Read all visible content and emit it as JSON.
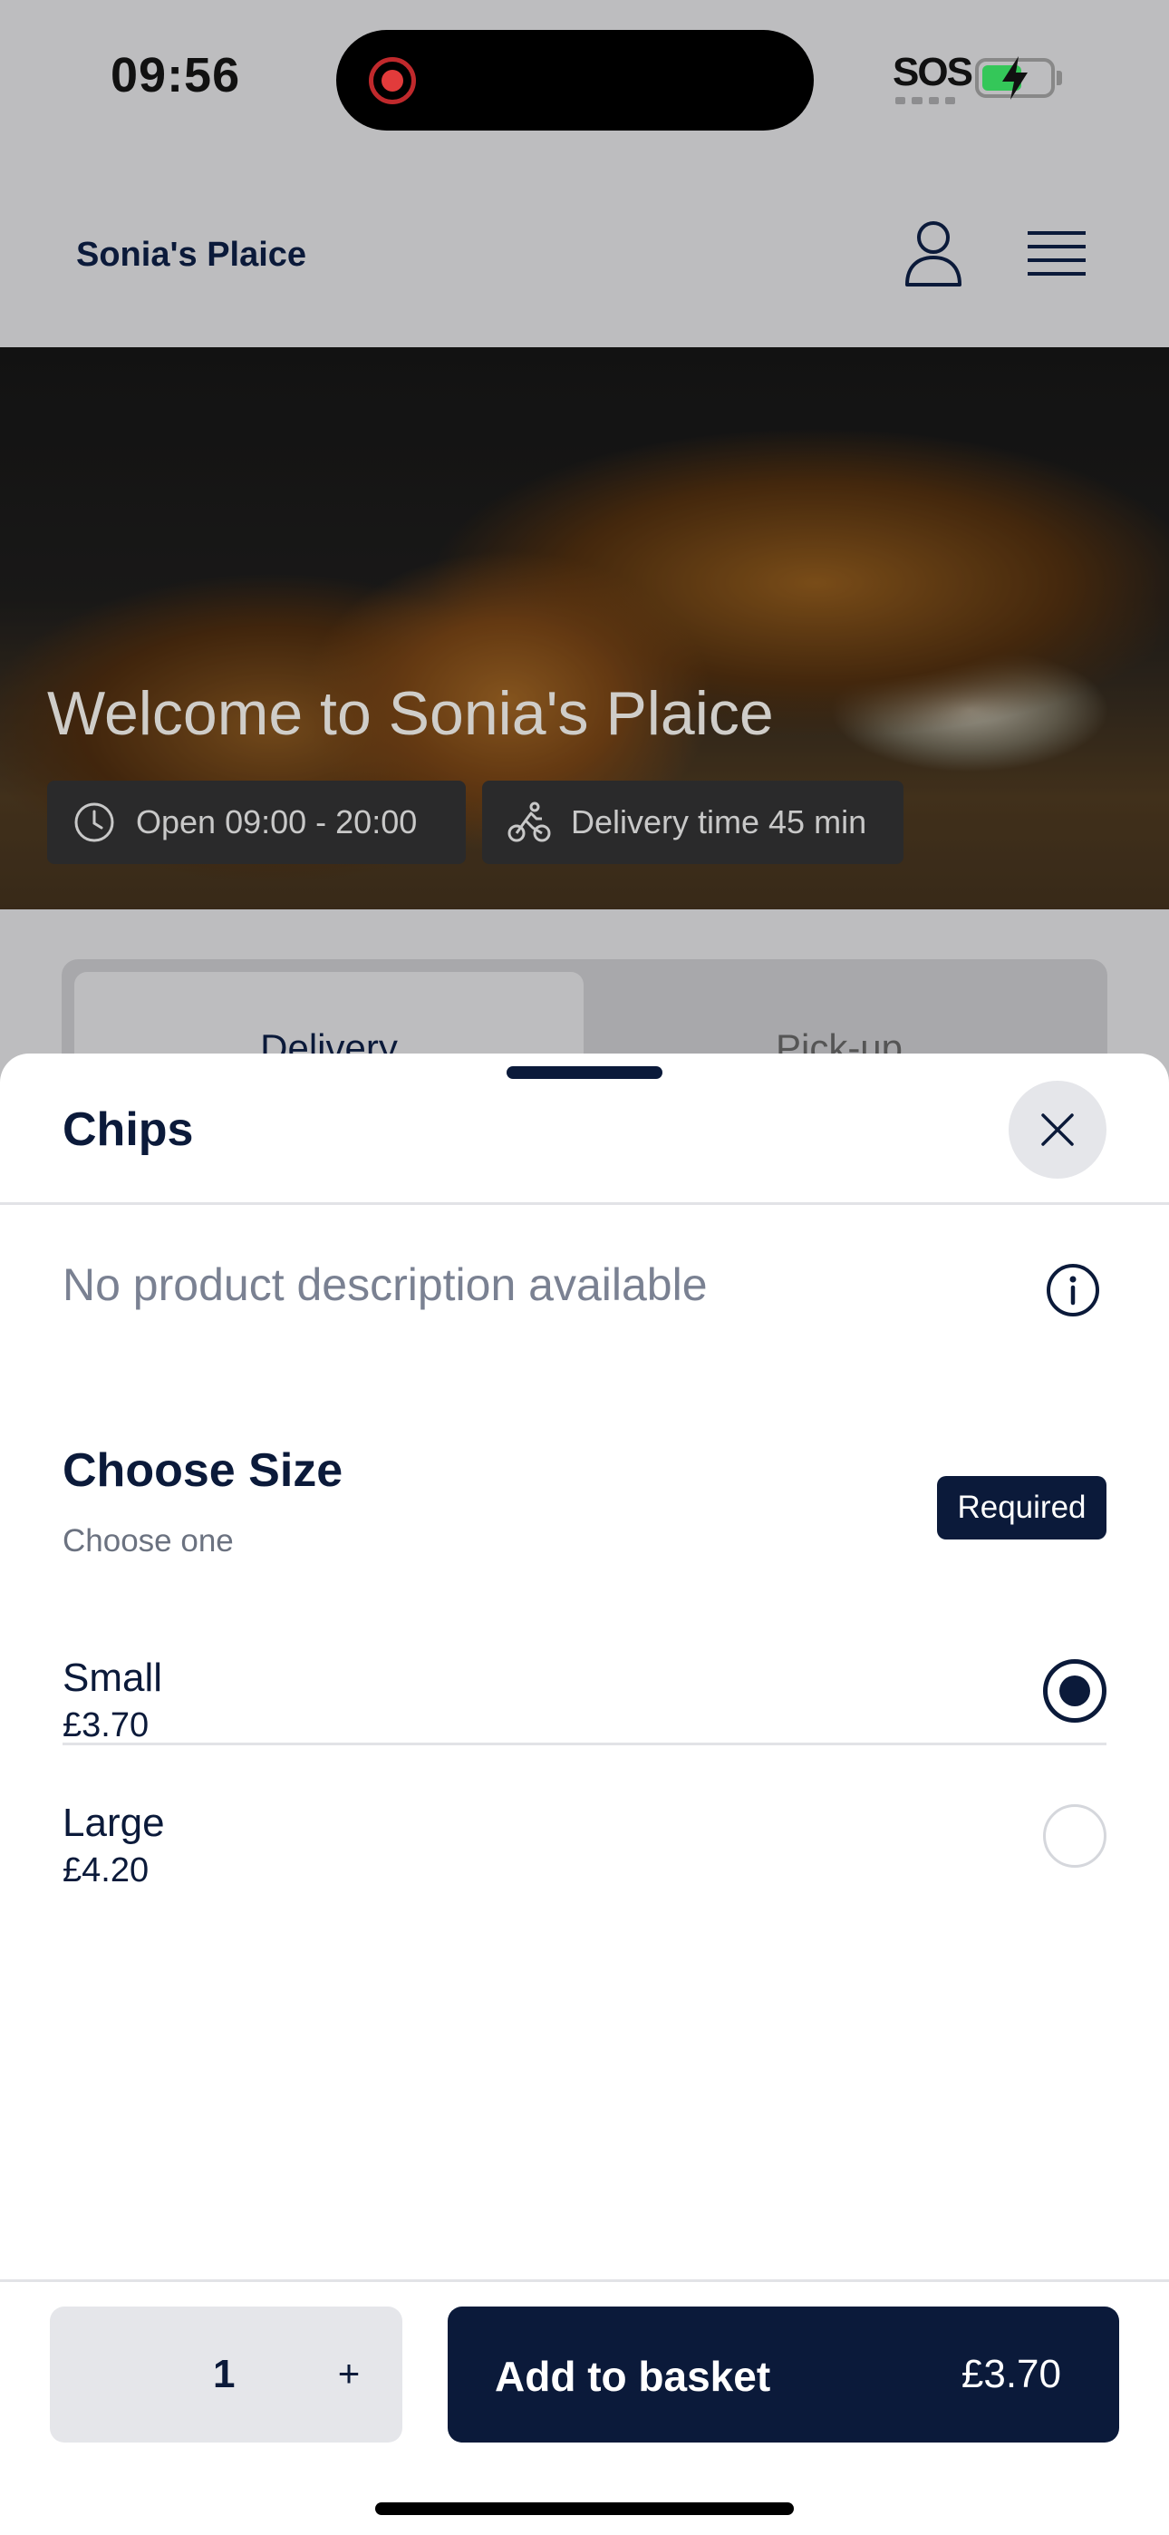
{
  "status_bar": {
    "time": "09:56",
    "carrier": "SOS"
  },
  "header": {
    "brand": "Sonia's Plaice",
    "icons": [
      "user-icon",
      "menu-icon"
    ]
  },
  "hero": {
    "title": "Welcome to Sonia's Plaice",
    "open_hours": "Open 09:00 - 20:00",
    "delivery_time": "Delivery time 45 min"
  },
  "mode_tabs": {
    "delivery": "Delivery",
    "pickup": "Pick-up",
    "selected": "Delivery"
  },
  "sheet": {
    "title": "Chips",
    "description": "No product description available",
    "group": {
      "title": "Choose Size",
      "subtitle": "Choose one",
      "badge": "Required",
      "options": [
        {
          "name": "Small",
          "price": "£3.70",
          "selected": true
        },
        {
          "name": "Large",
          "price": "£4.20",
          "selected": false
        }
      ]
    },
    "footer": {
      "quantity": "1",
      "plus": "+",
      "add_label": "Add to basket",
      "total": "£3.70"
    }
  },
  "colors": {
    "primary": "#0b1a3a",
    "overlay": "#bdbdbf",
    "muted_text": "#7a8192"
  }
}
